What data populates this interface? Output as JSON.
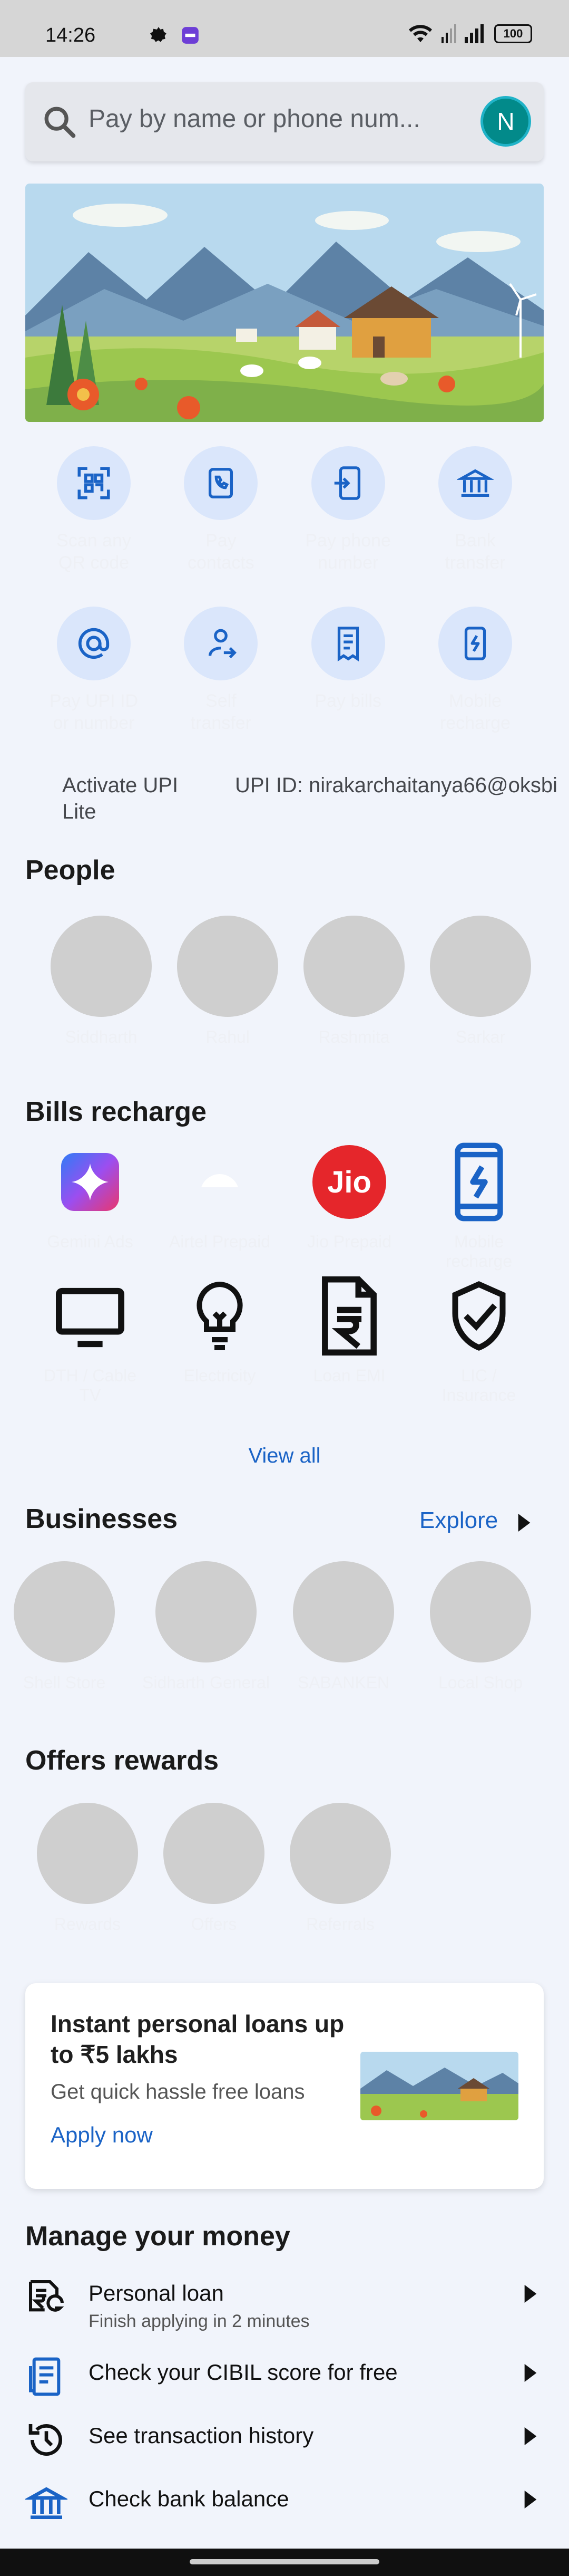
{
  "status_bar": {
    "time": "14:26",
    "battery": "100"
  },
  "search": {
    "placeholder": "Pay by name or phone num...",
    "avatar_initial": "N"
  },
  "quick_actions": [
    {
      "label": "Scan any QR code",
      "icon": "qr-scan-icon"
    },
    {
      "label": "Pay contacts",
      "icon": "contacts-icon"
    },
    {
      "label": "Pay phone number",
      "icon": "phone-transfer-icon"
    },
    {
      "label": "Bank transfer",
      "icon": "bank-icon"
    },
    {
      "label": "Pay UPI ID or number",
      "icon": "at-icon"
    },
    {
      "label": "Self transfer",
      "icon": "self-transfer-icon"
    },
    {
      "label": "Pay bills",
      "icon": "bill-icon"
    },
    {
      "label": "Mobile recharge",
      "icon": "mobile-recharge-icon"
    }
  ],
  "upi": {
    "activate_lite": "Activate UPI Lite",
    "upi_id": "UPI ID: nirakarchaitanya66@oksbi"
  },
  "people": {
    "title": "People",
    "names": [
      "Siddharth",
      "Rahul",
      "Rashmita",
      "Sarkar"
    ]
  },
  "bills": {
    "title": "Bills  recharge",
    "items": [
      {
        "label": "Gemini Ads",
        "icon": "gemini-icon"
      },
      {
        "label": "Airtel Prepaid",
        "icon": "airtel-icon"
      },
      {
        "label": "Jio Prepaid",
        "icon": "jio-logo-icon",
        "logo_text": "Jio"
      },
      {
        "label": "Mobile recharge",
        "icon": "mobile-recharge-icon"
      },
      {
        "label": "DTH / Cable TV",
        "icon": "tv-icon"
      },
      {
        "label": "Electricity",
        "icon": "bulb-icon"
      },
      {
        "label": "Loan EMI",
        "icon": "loan-emi-icon"
      },
      {
        "label": "LIC / Insurance",
        "icon": "shield-check-icon"
      }
    ],
    "view_all": "View all"
  },
  "businesses": {
    "title": "Businesses",
    "explore": "Explore",
    "names": [
      "Shell Store",
      "Sidharth General",
      "SABANKEN",
      "Local Shop"
    ]
  },
  "offers": {
    "title": "Offers  rewards",
    "names": [
      "Rewards",
      "Offers",
      "Referrals"
    ]
  },
  "loan_card": {
    "title": "Instant personal loans up to ₹5 lakhs",
    "subtitle": "Get quick  hassle free loans",
    "cta": "Apply now"
  },
  "manage_money": {
    "title": "Manage your money",
    "items": [
      {
        "label": "Personal loan",
        "sub": "Finish applying in 2 minutes",
        "icon": "personal-loan-icon"
      },
      {
        "label": "Check your CIBIL score for free",
        "icon": "cibil-report-icon"
      },
      {
        "label": "See transaction history",
        "icon": "history-icon"
      },
      {
        "label": "Check bank balance",
        "icon": "bank-icon"
      }
    ]
  },
  "colors": {
    "accent_blue": "#1a63c6",
    "icon_circle": "#dae6fb",
    "avatar": "#028a8a",
    "jio_red": "#e5262b"
  }
}
